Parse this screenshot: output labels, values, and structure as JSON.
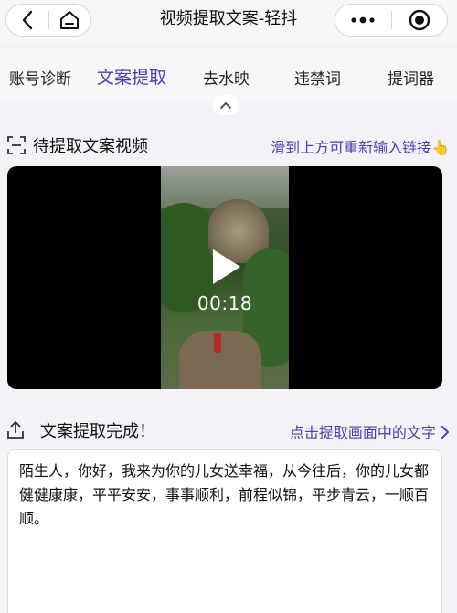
{
  "header": {
    "title": "视频提取文案-轻抖",
    "back_icon": "chevron-left-icon",
    "home_icon": "home-icon",
    "more_icon": "more-dots-icon",
    "close_icon": "target-circle-icon"
  },
  "tabs": [
    {
      "label": "账号诊断",
      "active": false
    },
    {
      "label": "文案提取",
      "active": true
    },
    {
      "label": "去水映",
      "active": false
    },
    {
      "label": "违禁词",
      "active": false
    },
    {
      "label": "提词器",
      "active": false
    }
  ],
  "video_section": {
    "title": "待提取文案视频",
    "link": "滑到上方可重新输入链接👆",
    "duration": "00:18"
  },
  "result_section": {
    "title": "文案提取完成！",
    "link": "点击提取画面中的文字",
    "text": "陌生人，你好，我来为你的儿女送幸福，从今往后，你的儿女都健健康康，平平安安，事事顺利，前程似锦，平步青云，一顺百顺。"
  },
  "colors": {
    "accent": "#4b3fb0",
    "background": "#f3f3f7"
  }
}
